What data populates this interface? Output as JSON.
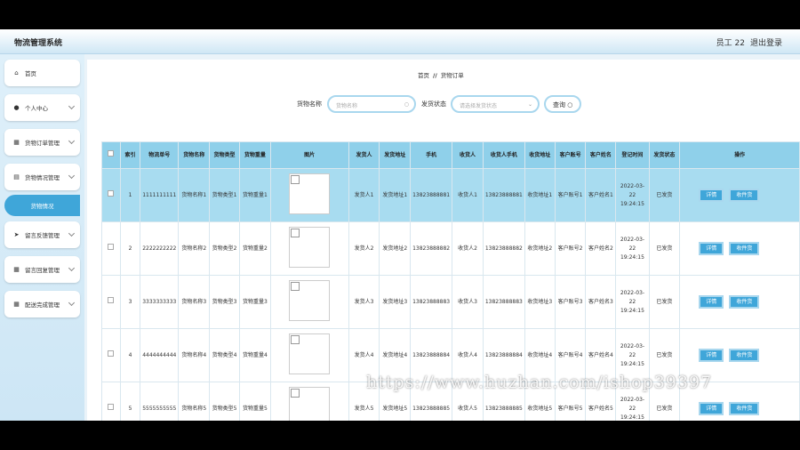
{
  "header": {
    "title": "物流管理系统",
    "user": "员工 22",
    "logout": "退出登录"
  },
  "sidebar": {
    "items": [
      {
        "label": "首页",
        "icon": "home-icon"
      },
      {
        "label": "个人中心",
        "icon": "user-icon"
      },
      {
        "label": "货物订单管理",
        "icon": "grid-icon"
      },
      {
        "label": "货物情况管理",
        "icon": "document-icon"
      },
      {
        "label": "留言反馈管理",
        "icon": "send-icon"
      },
      {
        "label": "留言回复管理",
        "icon": "grid-icon"
      },
      {
        "label": "配送完成管理",
        "icon": "grid-icon"
      }
    ],
    "active_sub": "货物情况"
  },
  "breadcrumb": {
    "home": "首页",
    "sep": "//",
    "current": "货物订单"
  },
  "search": {
    "name_label": "货物名称",
    "name_placeholder": "货物名称",
    "status_label": "发货状态",
    "status_placeholder": "请选择发货状态",
    "button": "查询"
  },
  "table": {
    "headers": [
      "",
      "索引",
      "物流单号",
      "货物名称",
      "货物类型",
      "货物重量",
      "图片",
      "发货人",
      "发货地址",
      "手机",
      "收货人",
      "收货人手机",
      "收货地址",
      "客户账号",
      "客户姓名",
      "登记时间",
      "发货状态",
      "操作"
    ],
    "rows": [
      [
        "1",
        "1111111111",
        "货物名称1",
        "货物类型1",
        "货物重量1",
        "发货人1",
        "发货地址1",
        "13823888881",
        "收货人1",
        "13823888881",
        "收货地址1",
        "客户账号1",
        "客户姓名1",
        "2022-03-22 19:24:15",
        "已发货"
      ],
      [
        "2",
        "2222222222",
        "货物名称2",
        "货物类型2",
        "货物重量2",
        "发货人2",
        "发货地址2",
        "13823888882",
        "收货人2",
        "13823888882",
        "收货地址2",
        "客户账号2",
        "客户姓名2",
        "2022-03-22 19:24:15",
        "已发货"
      ],
      [
        "3",
        "3333333333",
        "货物名称3",
        "货物类型3",
        "货物重量3",
        "发货人3",
        "发货地址3",
        "13823888883",
        "收货人3",
        "13823888883",
        "收货地址3",
        "客户账号3",
        "客户姓名3",
        "2022-03-22 19:24:15",
        "已发货"
      ],
      [
        "4",
        "4444444444",
        "货物名称4",
        "货物类型4",
        "货物重量4",
        "发货人4",
        "发货地址4",
        "13823888884",
        "收货人4",
        "13823888884",
        "收货地址4",
        "客户账号4",
        "客户姓名4",
        "2022-03-22 19:24:15",
        "已发货"
      ],
      [
        "5",
        "5555555555",
        "货物名称5",
        "货物类型5",
        "货物重量5",
        "发货人5",
        "发货地址5",
        "13823888885",
        "收货人5",
        "13823888885",
        "收货地址5",
        "客户账号5",
        "客户姓名5",
        "2022-03-22 19:24:15",
        "已发货"
      ]
    ],
    "actions": {
      "detail": "详情",
      "receive": "收件货"
    }
  },
  "watermark": "https://www.huzhan.com/ishop39397",
  "colors": {
    "accent": "#3fa6d9",
    "header_bg": "#8fd0ea",
    "selected_row": "#a8dcf0"
  }
}
